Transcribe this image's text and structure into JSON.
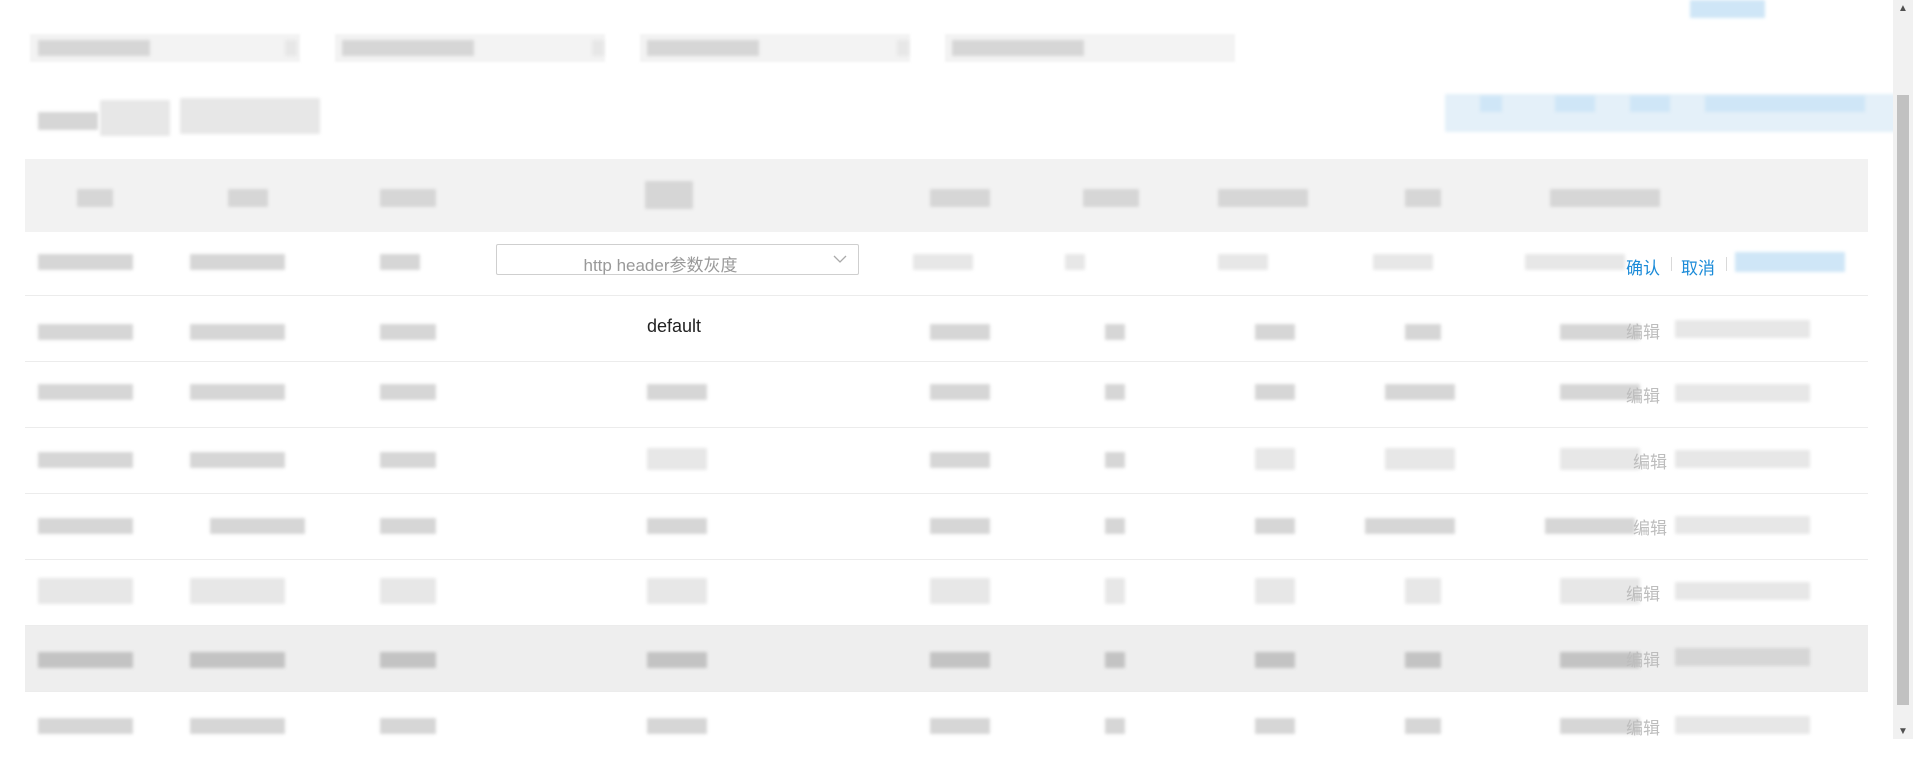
{
  "table": {
    "editing_row": {
      "select_value": "http header参数灰度",
      "confirm_label": "确认",
      "cancel_label": "取消"
    },
    "rows": [
      {
        "strategy": "default",
        "edit_label": "编辑"
      },
      {
        "strategy": "",
        "edit_label": "编辑"
      },
      {
        "strategy": "",
        "edit_label": "编辑"
      },
      {
        "strategy": "",
        "edit_label": "编辑"
      },
      {
        "strategy": "",
        "edit_label": "编辑"
      },
      {
        "strategy": "",
        "edit_label": "编辑"
      },
      {
        "strategy": "",
        "edit_label": "编辑"
      }
    ]
  },
  "colors": {
    "link_blue": "#1b8bd8",
    "disabled_gray": "#bdbdbd",
    "header_bg": "#f2f2f2",
    "hover_row_bg": "#eeeeee"
  },
  "icons": {
    "select_arrow": "chevron-down-icon",
    "scroll_up": "triangle-up-icon",
    "scroll_down": "triangle-down-icon"
  }
}
